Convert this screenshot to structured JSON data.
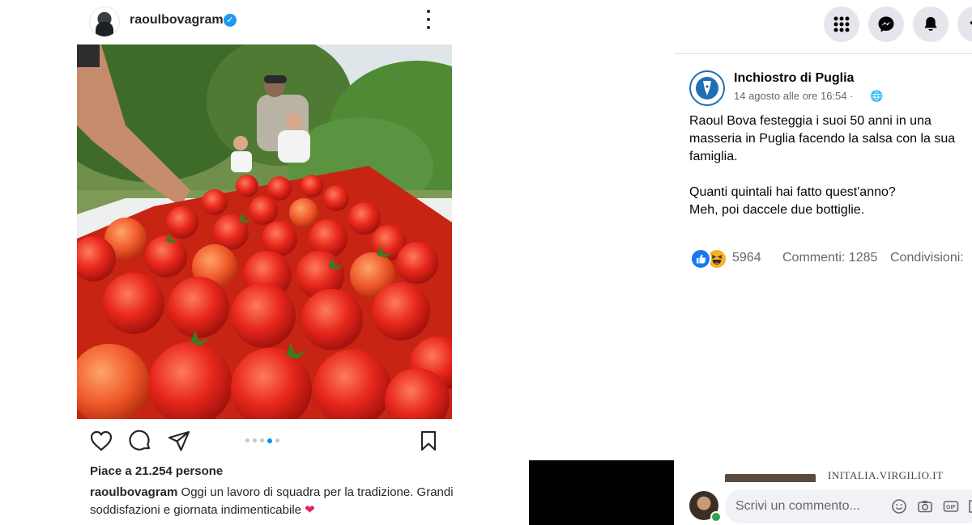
{
  "instagram": {
    "username": "raoulbovagram",
    "verified_mark": "✓",
    "likes_text": "Piace a 21.254 persone",
    "caption_user": "raoulbovagram",
    "caption_text": "Oggi un lavoro di squadra per la tradizione. Grandi soddisfazioni e giornata indimenticabile",
    "caption_emoji": "❤",
    "carousel": {
      "total": 5,
      "active": 4
    },
    "icons": [
      "heart-icon",
      "comment-icon",
      "share-icon",
      "bookmark-icon",
      "more-options-icon"
    ]
  },
  "facebook": {
    "topbar_icons": [
      "apps-grid-icon",
      "messenger-icon",
      "notifications-bell-icon",
      "account-menu-icon"
    ],
    "post": {
      "page_name": "Inchiostro di Puglia",
      "date": "14 agosto alle ore 16:54 ·",
      "globe": "🌐",
      "text_lines": [
        "Raoul Bova festeggia i suoi 50 anni in una masseria in Puglia facendo la salsa con la sua famiglia.",
        "Quanti quintali hai fatto quest'anno?",
        "Meh, poi daccele due bottiglie."
      ],
      "reactions_count": "5964",
      "comments": "Commenti: 1285",
      "shares": "Condivisioni:"
    },
    "news_source": "INITALIA.VIRGILIO.IT",
    "comment_placeholder": "Scrivi un commento..."
  },
  "colors": {
    "fb_blue": "#1877f2",
    "ig_active_dot": "#0095f6",
    "fb_button_bg": "#e4e6eb",
    "secondary_text": "#65676b"
  }
}
